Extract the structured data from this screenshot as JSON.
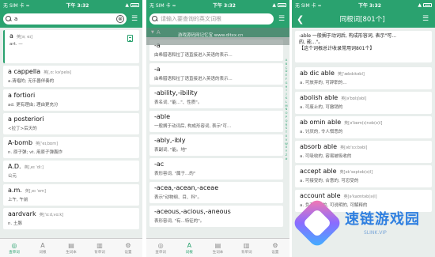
{
  "status": {
    "carrier": "无 SIM 卡",
    "wifi": "≈",
    "time": "下午 3:32",
    "signal": "▲"
  },
  "phone1": {
    "search_value": "a",
    "clear_symbol": "⊗",
    "filter_symbol": "☰",
    "entries": [
      {
        "word": "a",
        "phon": "英[ə; eɪ]",
        "def": "art. —"
      },
      {
        "word": "a cappella",
        "phon": "英[ˌɑː kəˈpelə]",
        "def": "a.清唱的; 无乐器伴奏的"
      },
      {
        "word": "a fortiori",
        "phon": "",
        "def": "ad. 更有理由; 理由更充分"
      },
      {
        "word": "a posteriori",
        "phon": "",
        "def": "<拉丁>后天的"
      },
      {
        "word": "A-bomb",
        "phon": "英['eɪ,bɒm]",
        "def": "n. 原子弹; vt. 用原子弹轰炸"
      },
      {
        "word": "A.D.",
        "phon": "英[ˌeɪ ˈdiː]",
        "def": "公元"
      },
      {
        "word": "a.m.",
        "phon": "英[ˌeɪ ˈem]",
        "def": "上午, 午前"
      },
      {
        "word": "aardvark",
        "phon": "英['ɑːd,vɑːk]",
        "def": "n. 土豚"
      }
    ],
    "tabs": [
      {
        "icon": "◎",
        "label": "查单词"
      },
      {
        "icon": "A",
        "label": "词根"
      },
      {
        "icon": "▤",
        "label": "生词本"
      },
      {
        "icon": "▥",
        "label": "背单词"
      },
      {
        "icon": "⚙",
        "label": "设置"
      }
    ]
  },
  "phone2": {
    "search_placeholder": "请输入要查询的英文词根",
    "filter_symbol": "☰",
    "watermark": "游戏源码网记忆宝 www.ditxx.cn",
    "section": "A",
    "entries": [
      {
        "word": "-a",
        "def": "由希腊语和拉丁语直接进入英语的表示..."
      },
      {
        "word": "-a",
        "def": "由希腊语和拉丁语直接进入英语的表示..."
      },
      {
        "word": "-ability,-ibility",
        "def": "表名词, \"能...\"、性质\"。"
      },
      {
        "word": "-able",
        "def": "一般搁于动词后, 构成形容词, 表示\"可..."
      },
      {
        "word": "-ably,-ibly",
        "def": "表副词, \"能。地\""
      },
      {
        "word": "-ac",
        "def": "表形容词, \"属于...的\""
      },
      {
        "word": "-acea,-acean,-aceae",
        "def": "表示\"动物纲、目、科\"。"
      },
      {
        "word": "-aceous,-acious,-aneous",
        "def": "表形容词, \"有...特征的\"。"
      }
    ],
    "alphabet": [
      "A",
      "B",
      "C",
      "D",
      "E",
      "F",
      "G",
      "H",
      "I",
      "J",
      "K",
      "L",
      "M",
      "N",
      "O",
      "P",
      "Q",
      "R",
      "S",
      "T",
      "U",
      "V",
      "W",
      "X",
      "Y",
      "Z",
      "#"
    ]
  },
  "phone3": {
    "back_symbol": "❮",
    "title": "同根词[801个]",
    "intro_lines": [
      "-able 一般搁于动词后, 构成形容词, 表示\"可...",
      "的, 能...\"。",
      "【这个词根总计收录常用词801个】"
    ],
    "entries": [
      {
        "word": "ab dic able",
        "phon": "英['æbdɪkəbl]",
        "def": "a. 可放弃的, 可辞职的..."
      },
      {
        "word": "abolish able",
        "phon": "英[ə'bɒlɪʃəbl]",
        "def": "a. 可废止的, 可撤销的"
      },
      {
        "word": "ab omin able",
        "phon": "英[ə'bɒm(ɪ)nəb(ə)l]",
        "def": "a. 讨厌的, 令人憎恶的"
      },
      {
        "word": "absorb able",
        "phon": "英[əb'sɔːbəbl]",
        "def": "a. 可吸收的, 容易被吸收的"
      },
      {
        "word": "accept able",
        "phon": "英[ək'septəb(ə)l]",
        "def": "a. 可接受的, 合意的, 可忍受的"
      },
      {
        "word": "account able",
        "phon": "英[ə'kaʊntəb(ə)l]",
        "def": "a. 负有责任的, 可说明的, 可解释的"
      }
    ]
  },
  "logo": {
    "brand": "速链游戏园",
    "url": "SLINK.VIP"
  }
}
